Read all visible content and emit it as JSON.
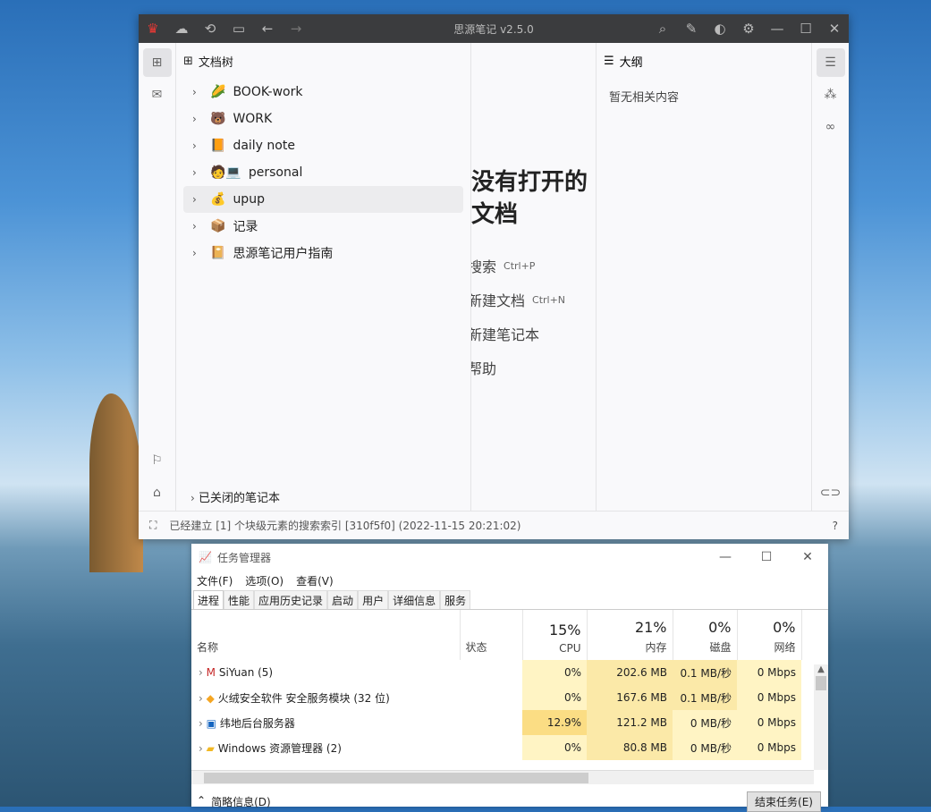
{
  "siyuan": {
    "title": "思源笔记 v2.5.0",
    "tree_header": "文档树",
    "notebooks": [
      {
        "icon": "🌽",
        "label": "BOOK-work"
      },
      {
        "icon": "🐻",
        "label": "WORK"
      },
      {
        "icon": "📙",
        "label": "daily note"
      },
      {
        "icon": "🧑💻",
        "label": "personal"
      },
      {
        "icon": "💰",
        "label": "upup",
        "selected": true
      },
      {
        "icon": "📦",
        "label": "记录"
      },
      {
        "icon": "📔",
        "label": "思源笔记用户指南"
      }
    ],
    "closed_notebooks": "已关闭的笔记本",
    "editor": {
      "empty_title": "没有打开的文档",
      "actions": [
        {
          "label": "搜索",
          "shortcut": "Ctrl+P"
        },
        {
          "label": "新建文档",
          "shortcut": "Ctrl+N"
        },
        {
          "label": "新建笔记本",
          "shortcut": ""
        },
        {
          "label": "帮助",
          "shortcut": ""
        }
      ]
    },
    "outline_header": "大纲",
    "outline_empty": "暂无相关内容",
    "status": "已经建立 [1] 个块级元素的搜索索引 [310f5f0] (2022-11-15 20:21:02)"
  },
  "taskmgr": {
    "title": "任务管理器",
    "menu": [
      "文件(F)",
      "选项(O)",
      "查看(V)"
    ],
    "tabs": [
      "进程",
      "性能",
      "应用历史记录",
      "启动",
      "用户",
      "详细信息",
      "服务"
    ],
    "columns": {
      "name": "名称",
      "status": "状态",
      "cpu_pct": "15%",
      "cpu": "CPU",
      "mem_pct": "21%",
      "mem": "内存",
      "disk_pct": "0%",
      "disk": "磁盘",
      "net_pct": "0%",
      "net": "网络"
    },
    "rows": [
      {
        "name": "SiYuan (5)",
        "cpu": "0%",
        "mem": "202.6 MB",
        "disk": "0.1 MB/秒",
        "net": "0 Mbps"
      },
      {
        "name": "火绒安全软件 安全服务模块 (32 位)",
        "cpu": "0%",
        "mem": "167.6 MB",
        "disk": "0.1 MB/秒",
        "net": "0 Mbps"
      },
      {
        "name": "纬地后台服务器",
        "cpu": "12.9%",
        "mem": "121.2 MB",
        "disk": "0 MB/秒",
        "net": "0 Mbps"
      },
      {
        "name": "Windows 资源管理器 (2)",
        "cpu": "0%",
        "mem": "80.8 MB",
        "disk": "0 MB/秒",
        "net": "0 Mbps"
      }
    ],
    "fewer_details": "简略信息(D)",
    "end_task": "结束任务(E)"
  }
}
